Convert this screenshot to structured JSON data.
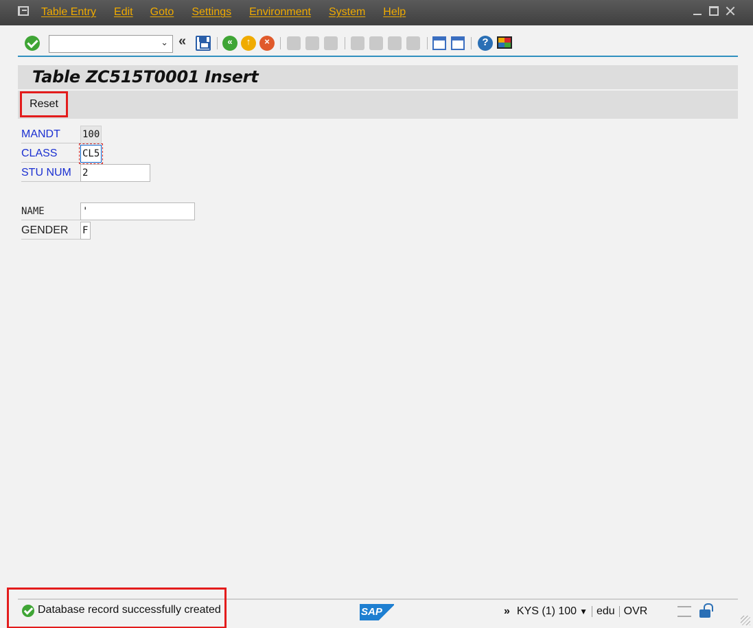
{
  "menu": {
    "items": [
      "Table Entry",
      "Edit",
      "Goto",
      "Settings",
      "Environment",
      "System",
      "Help"
    ]
  },
  "toolbar": {
    "command_field_value": "",
    "icons": [
      "confirm-icon",
      "save-icon",
      "back-icon",
      "exit-icon",
      "cancel-icon",
      "print-icon",
      "find-icon",
      "find-next-icon",
      "first-page-icon",
      "prev-page-icon",
      "next-page-icon",
      "last-page-icon",
      "new-session-icon",
      "shortcut-icon",
      "help-icon",
      "customize-layout-icon"
    ]
  },
  "page": {
    "title": "Table ZC515T0001 Insert"
  },
  "app_toolbar": {
    "reset_label": "Reset"
  },
  "form": {
    "fields": [
      {
        "label": "MANDT",
        "value": "100"
      },
      {
        "label": "CLASS",
        "value": "CL5"
      },
      {
        "label": "STU NUM",
        "value": "2"
      },
      {
        "label": "NAME",
        "value": "'"
      },
      {
        "label": "GENDER",
        "value": "F"
      }
    ]
  },
  "status": {
    "message": "Database record successfully created",
    "sap_logo": "SAP",
    "system": "KYS (1) 100",
    "user": "edu",
    "mode": "OVR"
  },
  "colors": {
    "accent": "#f0ab00",
    "key_label": "#1a2fd1",
    "highlight": "#e31c1c"
  }
}
